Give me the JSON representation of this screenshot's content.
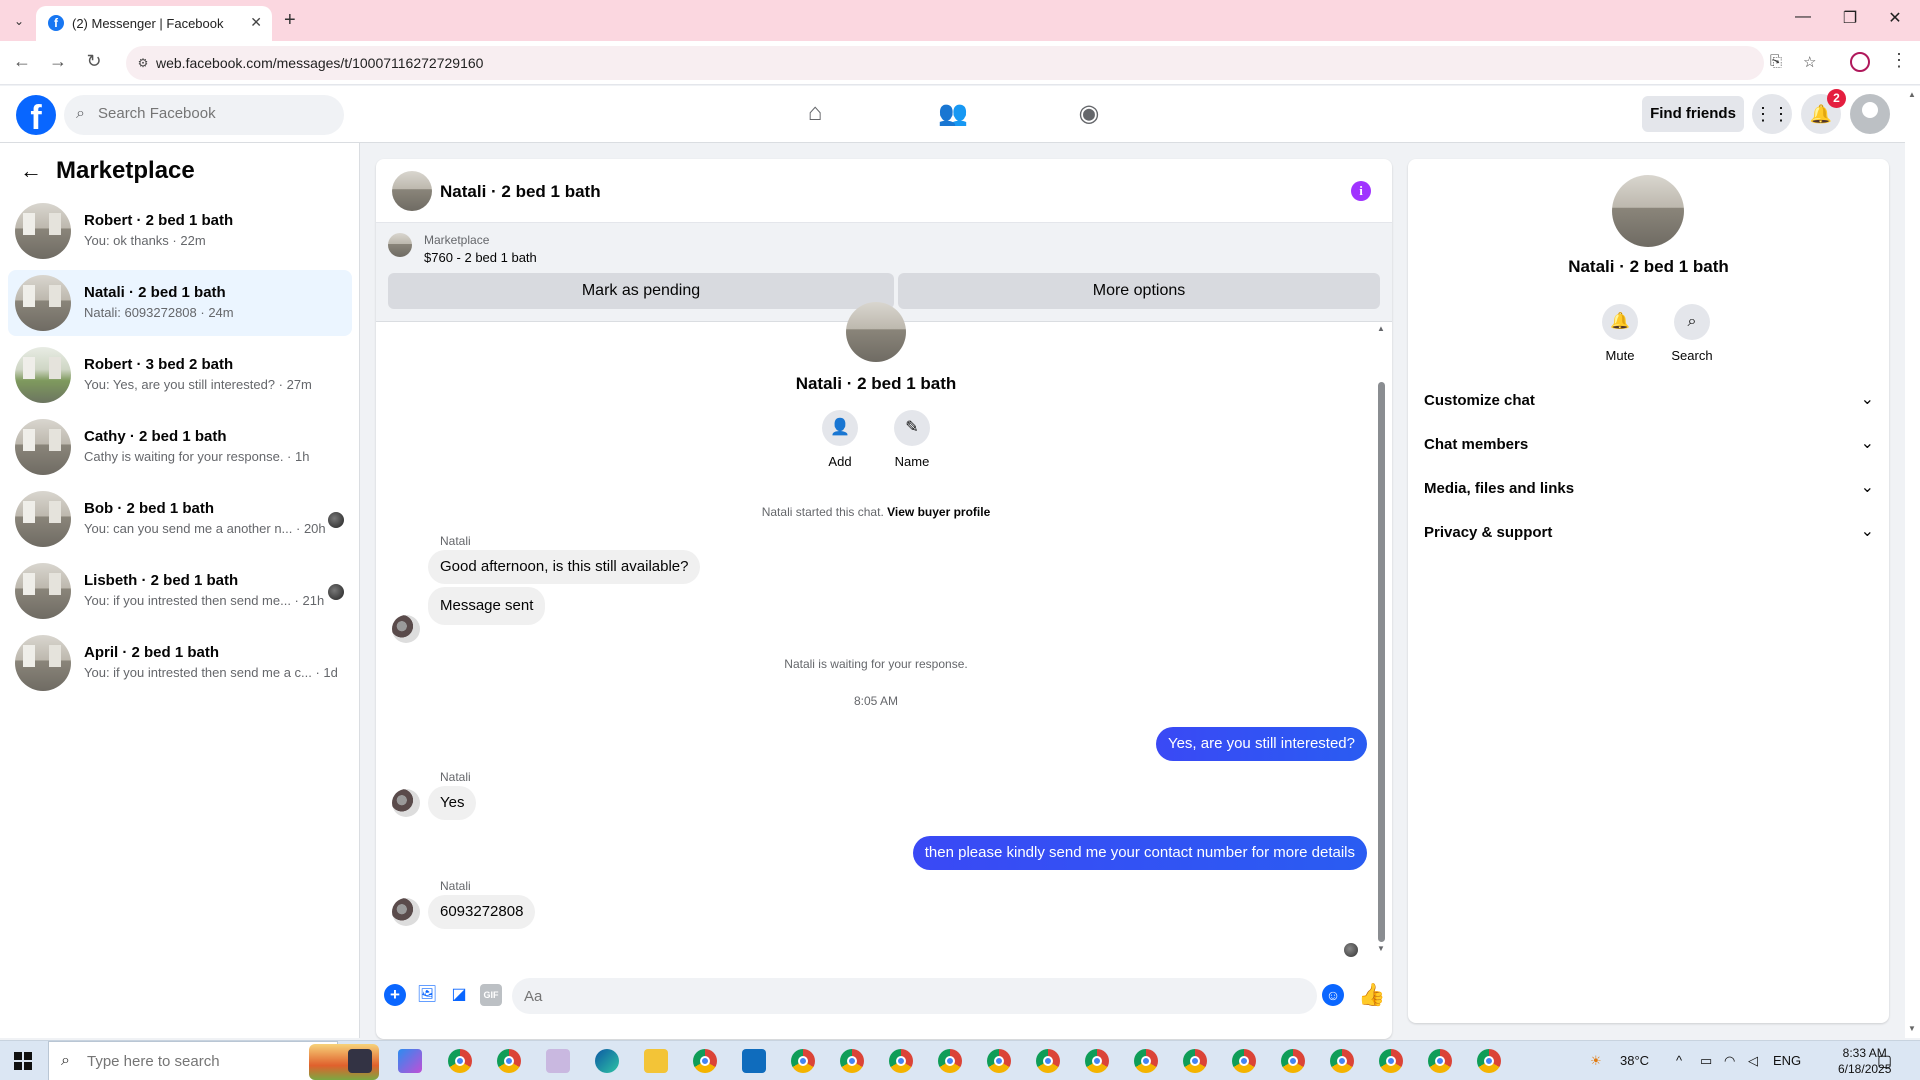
{
  "browser": {
    "tab_title": "(2) Messenger | Facebook",
    "url": "web.facebook.com/messages/t/10007116272729160"
  },
  "fb": {
    "search_placeholder": "Search Facebook",
    "find_friends": "Find friends",
    "notification_count": "2"
  },
  "sidebar": {
    "title": "Marketplace",
    "conversations": [
      {
        "name": "Robert · 2 bed 1 bath",
        "preview": "You: ok thanks · 22m"
      },
      {
        "name": "Natali · 2 bed 1 bath",
        "preview": "Natali: 6093272808 · 24m"
      },
      {
        "name": "Robert · 3 bed 2 bath",
        "preview": "You: Yes, are you still interested? · 27m"
      },
      {
        "name": "Cathy · 2 bed 1 bath",
        "preview": "Cathy is waiting for your response. · 1h"
      },
      {
        "name": "Bob · 2 bed 1 bath",
        "preview": "You: can you send me a another n... · 20h"
      },
      {
        "name": "Lisbeth · 2 bed 1 bath",
        "preview": "You: if you intrested then send me... · 21h"
      },
      {
        "name": "April · 2 bed 1 bath",
        "preview": "You: if you intrested then send me a c... · 1d"
      }
    ]
  },
  "chat": {
    "title": "Natali · 2 bed 1 bath",
    "marketplace_label": "Marketplace",
    "listing": "$760 - 2 bed 1 bath",
    "mark_pending": "Mark as pending",
    "more_options": "More options",
    "header_name": "Natali · 2 bed 1 bath",
    "add_label": "Add",
    "name_label": "Name",
    "started_text": "Natali started this chat.",
    "view_profile": "View buyer profile",
    "waiting_text": "Natali is waiting for your response.",
    "time_stamp": "8:05 AM",
    "sender_name": "Natali",
    "messages": {
      "m1": "Good afternoon, is this still available?",
      "m2": "Message sent",
      "m3": "Yes, are you still interested?",
      "m4": "Yes",
      "m5": "then please kindly send me your contact number for more details",
      "m6": "6093272808"
    },
    "composer_placeholder": "Aa",
    "gif_label": "GIF"
  },
  "info_panel": {
    "name": "Natali · 2 bed 1 bath",
    "mute": "Mute",
    "search": "Search",
    "sections": [
      "Customize chat",
      "Chat members",
      "Media, files and links",
      "Privacy & support"
    ]
  },
  "taskbar": {
    "search_placeholder": "Type here to search",
    "temperature": "38°C",
    "language": "ENG",
    "time": "8:33 AM",
    "date": "6/18/2025"
  }
}
